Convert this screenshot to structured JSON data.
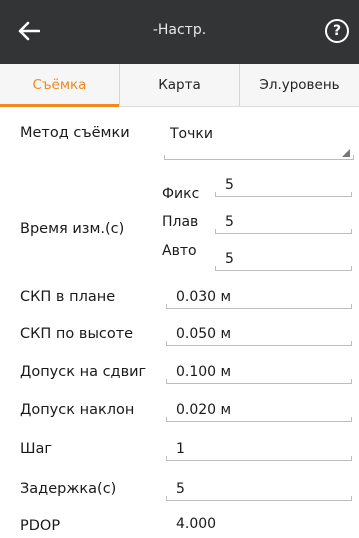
{
  "header": {
    "title": "-Настр.",
    "back_icon": "arrow-left-icon",
    "help_label": "?"
  },
  "tabs": [
    {
      "label": "Съёмка",
      "active": true
    },
    {
      "label": "Карта",
      "active": false
    },
    {
      "label": "Эл.уровень",
      "active": false
    }
  ],
  "method": {
    "label": "Метод съёмки",
    "value": "Точки"
  },
  "time": {
    "label": "Время изм.(с)",
    "fix_label": "Фикс",
    "fix_value": "5",
    "float_label": "Плав",
    "float_value": "5",
    "auto_label": "Авто",
    "auto_value": "5"
  },
  "fields": {
    "hrms": {
      "label": "СКП в плане",
      "value": "0.030 м"
    },
    "vrms": {
      "label": "СКП по высоте",
      "value": "0.050 м"
    },
    "shift_tol": {
      "label": "Допуск на сдвиг",
      "value": "0.100 м"
    },
    "tilt_tol": {
      "label": "Допуск наклон",
      "value": "0.020 м"
    },
    "step": {
      "label": "Шаг",
      "value": "1"
    },
    "delay": {
      "label": "Задержка(с)",
      "value": "5"
    },
    "pdop": {
      "label": "PDOP",
      "value": "4.000"
    }
  },
  "colors": {
    "accent": "#f08a1c",
    "topbar": "#333436"
  }
}
